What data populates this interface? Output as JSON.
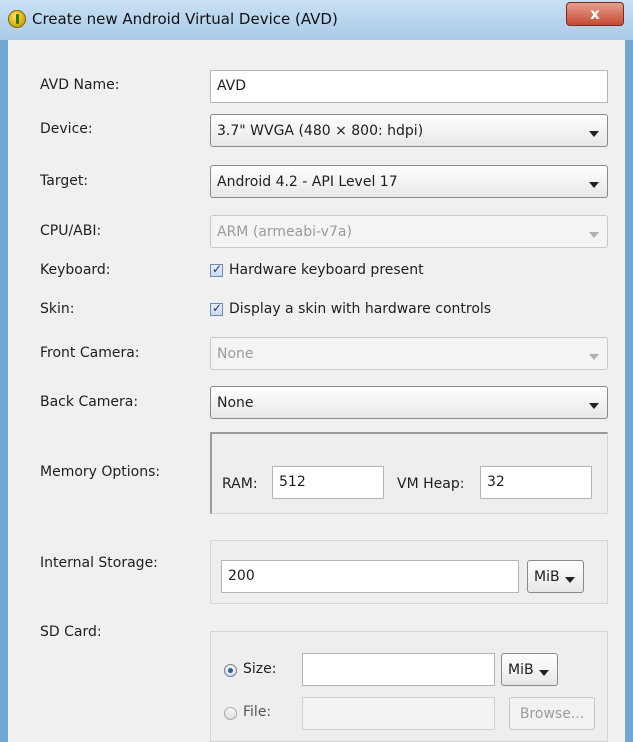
{
  "window": {
    "title": "Create new Android Virtual Device (AVD)",
    "close_label": "x"
  },
  "form": {
    "avd_name": {
      "label": "AVD Name:",
      "value": "AVD"
    },
    "device": {
      "label": "Device:",
      "value": "3.7\" WVGA (480 × 800: hdpi)"
    },
    "target": {
      "label": "Target:",
      "value": "Android 4.2 - API Level 17"
    },
    "cpu_abi": {
      "label": "CPU/ABI:",
      "value": "ARM (armeabi-v7a)",
      "disabled": true
    },
    "keyboard": {
      "label": "Keyboard:",
      "checkbox_label": "Hardware keyboard present",
      "checked": true
    },
    "skin": {
      "label": "Skin:",
      "checkbox_label": "Display a skin with hardware controls",
      "checked": true
    },
    "front_camera": {
      "label": "Front Camera:",
      "value": "None",
      "disabled": true
    },
    "back_camera": {
      "label": "Back Camera:",
      "value": "None"
    },
    "memory": {
      "label": "Memory Options:",
      "ram_label": "RAM:",
      "ram_value": "512",
      "vm_heap_label": "VM Heap:",
      "vm_heap_value": "32"
    },
    "internal_storage": {
      "label": "Internal Storage:",
      "value": "200",
      "unit": "MiB"
    },
    "sd_card": {
      "label": "SD Card:",
      "size_label": "Size:",
      "size_value": "",
      "size_unit": "MiB",
      "size_selected": true,
      "file_label": "File:",
      "file_value": "",
      "browse_label": "Browse..."
    }
  },
  "colors": {
    "title_bar": "#a9cbe8",
    "close_button": "#c74a32",
    "dialog_bg": "#f0f0f0"
  }
}
